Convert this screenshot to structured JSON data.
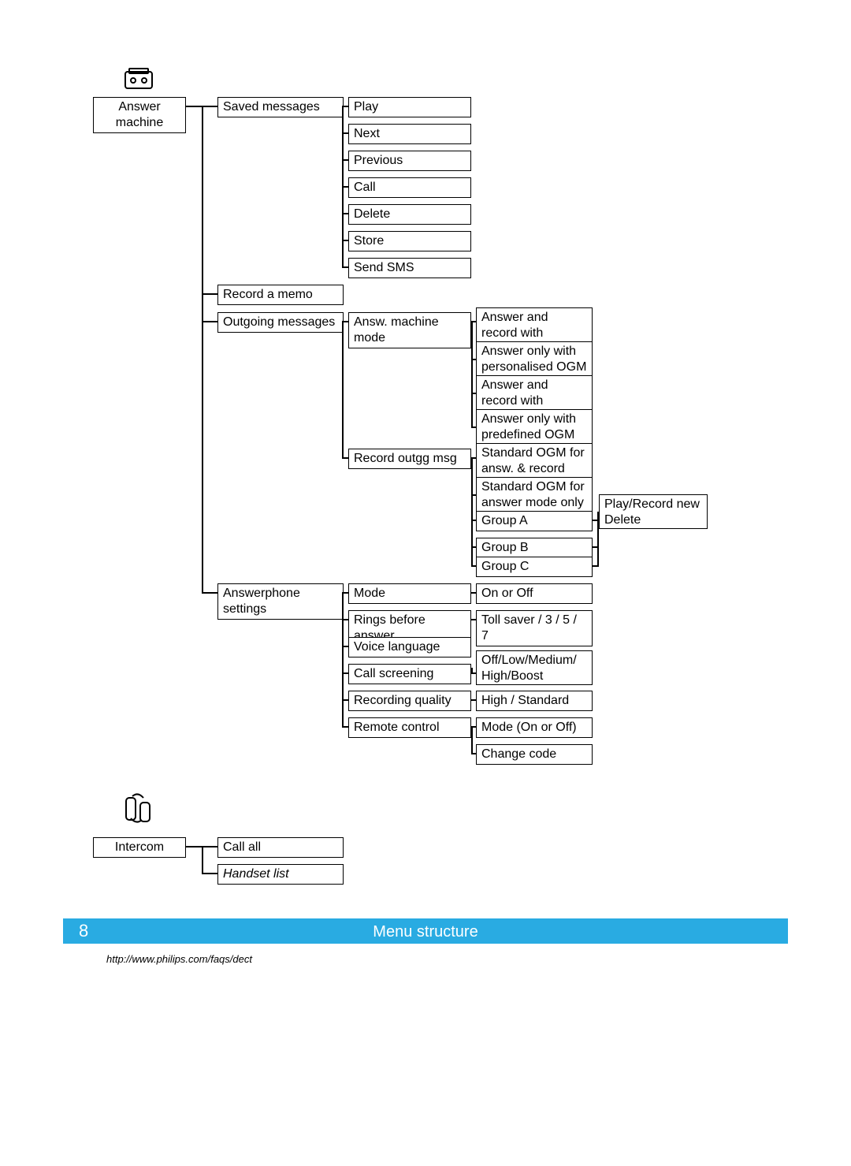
{
  "page_number": "8",
  "footer_title": "Menu structure",
  "footer_url": "http://www.philips.com/faqs/dect",
  "icons": {
    "answer_machine": "answer-machine-icon",
    "intercom": "intercom-icon"
  },
  "answer_machine": {
    "root": "Answer machine",
    "saved_messages": {
      "label": "Saved messages",
      "play": "Play",
      "next": "Next",
      "previous": "Previous",
      "call": "Call",
      "delete": "Delete",
      "store": "Store",
      "send_sms": "Send SMS"
    },
    "record_memo": "Record a memo",
    "outgoing_messages": {
      "label": "Outgoing messages",
      "answ_machine_mode": {
        "label": "Answ. machine mode",
        "o1": "Answer and record with personalised OGM",
        "o2": "Answer only with personalised OGM",
        "o3": "Answer and record with predefined OGM",
        "o4": "Answer only with predefined OGM"
      },
      "record_outgg_msg": {
        "label": "Record outgg msg",
        "o1": "Standard OGM for answ. & record mode",
        "o2": "Standard OGM for answer mode only",
        "ga": "Group A",
        "gb": "Group B",
        "gc": "Group C",
        "group_actions": {
          "a1": "Play/Record new",
          "a2": "Delete"
        }
      }
    },
    "settings": {
      "label": "Answerphone settings",
      "mode": {
        "label": "Mode",
        "opt": "On or Off"
      },
      "rings": {
        "label": "Rings before answer",
        "opt": "Toll saver / 3 / 5 / 7"
      },
      "voice_language": {
        "label": "Voice language"
      },
      "call_screening": {
        "label": "Call screening",
        "opt": "Off/Low/Medium/ High/Boost"
      },
      "recording_quality": {
        "label": "Recording quality",
        "opt": "High / Standard"
      },
      "remote_control": {
        "label": "Remote control",
        "opt1": "Mode (On or Off)",
        "opt2": "Change code"
      }
    }
  },
  "intercom": {
    "root": "Intercom",
    "call_all": "Call all",
    "handset_list": "Handset list"
  }
}
